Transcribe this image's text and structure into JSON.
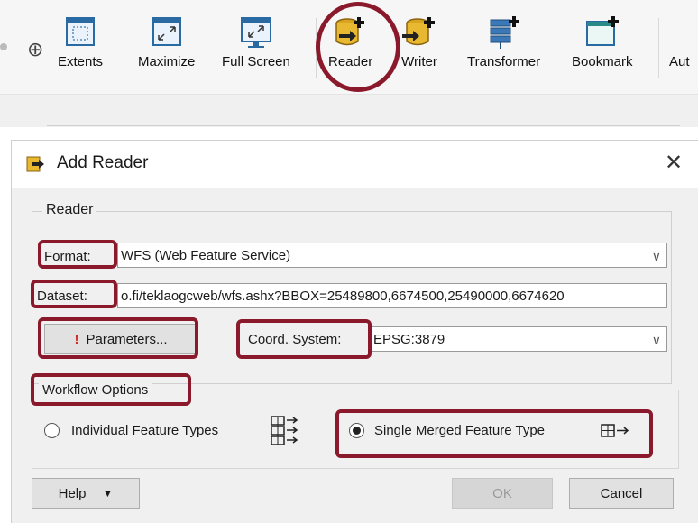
{
  "toolbar": {
    "items": [
      {
        "label": "Extents",
        "icon": "extents-icon"
      },
      {
        "label": "Maximize",
        "icon": "maximize-icon"
      },
      {
        "label": "Full Screen",
        "icon": "full-screen-icon"
      },
      {
        "label": "Reader",
        "icon": "add-reader-icon"
      },
      {
        "label": "Writer",
        "icon": "add-writer-icon"
      },
      {
        "label": "Transformer",
        "icon": "add-transformer-icon"
      },
      {
        "label": "Bookmark",
        "icon": "add-bookmark-icon"
      },
      {
        "label": "Aut",
        "icon": ""
      }
    ],
    "zoom_in_glyph": "⊕"
  },
  "dialog": {
    "title": "Add Reader",
    "close_glyph": "✕",
    "group_label": "Reader",
    "format": {
      "label": "Format:",
      "value": "WFS (Web Feature Service)"
    },
    "dataset": {
      "label": "Dataset:",
      "value": "o.fi/teklaogcweb/wfs.ashx?BBOX=25489800,6674500,25490000,6674620"
    },
    "parameters_button": {
      "glyph": "!",
      "label": "Parameters..."
    },
    "coord_system": {
      "label": "Coord. System:",
      "value": "EPSG:3879"
    },
    "workflow": {
      "label": "Workflow Options",
      "option_individual": "Individual Feature Types",
      "option_merged": "Single Merged Feature Type",
      "selected": "Single Merged Feature Type"
    },
    "buttons": {
      "help": "Help",
      "ok": "OK",
      "cancel": "Cancel"
    }
  },
  "colors": {
    "highlight": "#8a1a2b",
    "dialog_bg": "#f0f0f0",
    "toolbar_bg": "#f6f6f6"
  }
}
